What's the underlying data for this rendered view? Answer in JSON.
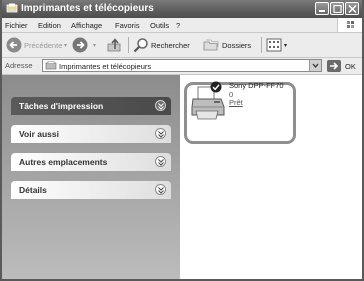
{
  "window": {
    "title": "Imprimantes et télécopieurs"
  },
  "menu": {
    "items": [
      "Fichier",
      "Edition",
      "Affichage",
      "Favoris",
      "Outils",
      "?"
    ]
  },
  "toolbar": {
    "back_label": "Précédente",
    "search_label": "Rechercher",
    "folders_label": "Dossiers"
  },
  "address": {
    "label": "Adresse",
    "value": "Imprimantes et télécopieurs",
    "go_label": "OK"
  },
  "sidebar": {
    "panels": [
      {
        "label": "Tâches d'impression"
      },
      {
        "label": "Voir aussi"
      },
      {
        "label": "Autres emplacements"
      },
      {
        "label": "Détails"
      }
    ]
  },
  "printer": {
    "name": "Sony DPP-FF70",
    "jobs": "0",
    "status": "Prêt"
  },
  "icons": {
    "title": "printer-folder-icon",
    "back": "back-arrow-icon",
    "forward": "forward-arrow-icon",
    "up": "folder-up-icon",
    "search": "magnifier-icon",
    "folders": "folders-icon",
    "views": "views-icon",
    "go": "go-arrow-icon",
    "printer": "printer-icon",
    "default": "default-check-icon",
    "chevron": "double-chevron-icon"
  },
  "colors": {
    "title_bar": "#5c5c5c",
    "side_pane": "#8c8c8c",
    "panel_dark": "#4a4a4a"
  }
}
